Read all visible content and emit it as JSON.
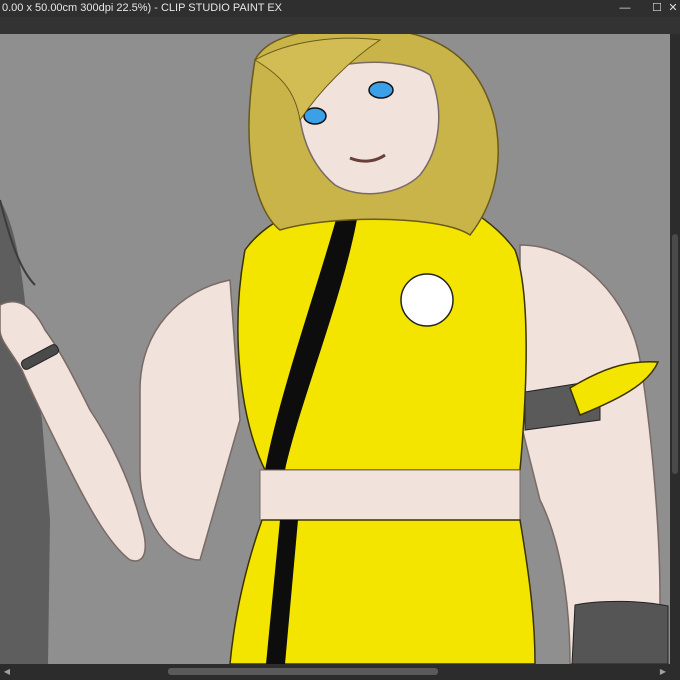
{
  "window": {
    "title": "0.00 x 50.00cm 300dpi 22.5%)  - CLIP STUDIO PAINT EX",
    "buttons": {
      "minimize": "—",
      "maximize": "☐",
      "close": "✕"
    }
  },
  "colors": {
    "title_bar": "#2f2f2f",
    "canvas_background": "#8f8f8f",
    "outfit_yellow": "#f4e500",
    "stripe_black": "#0d0d0d",
    "skin": "#f2e2dc",
    "hair": "#c9b44a",
    "eyes": "#3aa0e8"
  },
  "icons": [
    "minimize-icon",
    "maximize-icon",
    "close-icon",
    "scroll-left-icon",
    "scroll-right-icon"
  ]
}
